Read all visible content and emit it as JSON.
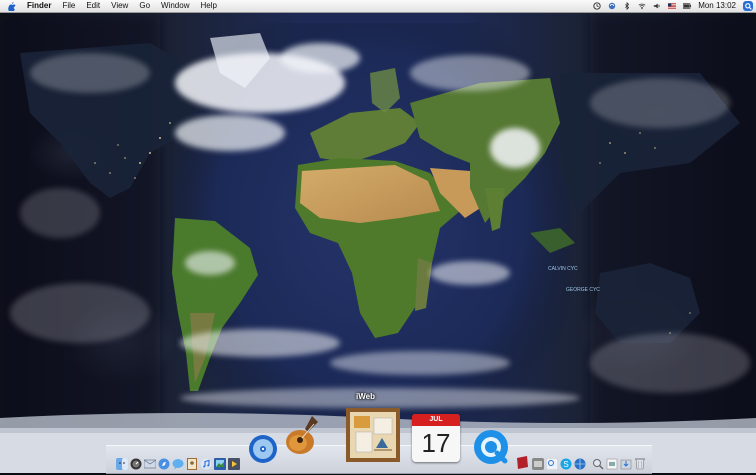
{
  "menubar": {
    "app_name": "Finder",
    "menus": [
      "File",
      "Edit",
      "View",
      "Go",
      "Window",
      "Help"
    ],
    "clock": "Mon 13:02"
  },
  "desktop": {
    "cyclone_labels": [
      "CALVIN CYC",
      "GEORGE CYC"
    ]
  },
  "dock": {
    "hover_label": "iWeb",
    "ical_month": "JUL",
    "ical_day": "17"
  },
  "colors": {
    "ocean": "#1e2a55",
    "land_green": "#4e7a2e",
    "desert": "#c8a060",
    "menubar": "#ececec",
    "accent": "#2a6fd6"
  }
}
